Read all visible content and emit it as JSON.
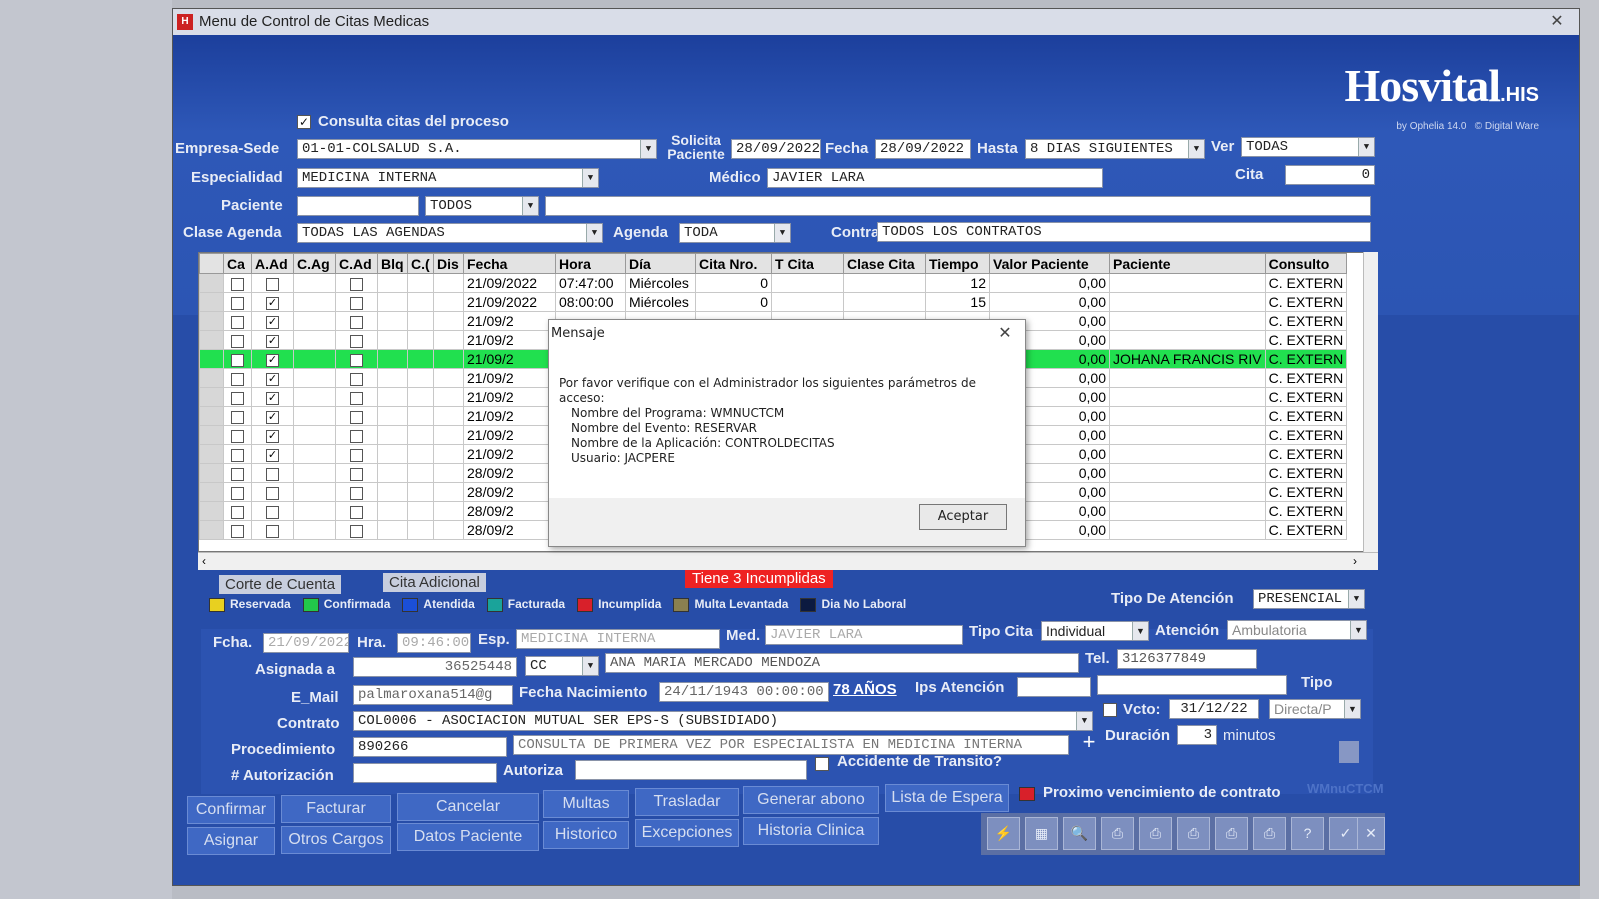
{
  "window": {
    "title": "Menu de Control de Citas Medicas",
    "close": "✕"
  },
  "logo": {
    "main": "Hosvital",
    "suffix": ".HIS",
    "by": "by Ophelia 14.0",
    "copyright": "© Digital Ware"
  },
  "filters": {
    "consulta_label": "Consulta citas del proceso",
    "empresa_label": "Empresa-Sede",
    "empresa_value": "01-01-COLSALUD S.A.",
    "solicita_label": "Solicita Paciente",
    "solicita_value": "28/09/2022",
    "fecha_label": "Fecha",
    "fecha_value": "28/09/2022",
    "hasta_label": "Hasta",
    "hasta_value": "8 DIAS SIGUIENTES",
    "ver_label": "Ver",
    "ver_value": "TODAS",
    "especialidad_label": "Especialidad",
    "especialidad_value": "MEDICINA INTERNA",
    "medico_label": "Médico",
    "medico_value": "JAVIER  LARA",
    "cita_label": "Cita",
    "cita_value": "0",
    "paciente_label": "Paciente",
    "paciente_value": "",
    "paciente_filter": "TODOS",
    "clase_label": "Clase Agenda",
    "clase_value": "TODAS LAS AGENDAS",
    "agenda_label": "Agenda",
    "agenda_value": "TODA",
    "contrato_label": "Contrato",
    "contrato_value": "TODOS LOS CONTRATOS"
  },
  "grid": {
    "columns": [
      "",
      "Ca",
      "A.Ad",
      "C.Ag",
      "C.Ad",
      "Blq",
      "C.(",
      "Dis",
      "Fecha",
      "Hora",
      "Día",
      "Cita Nro.",
      "T Cita",
      "Clase Cita",
      "Tiempo",
      "Valor Paciente",
      "Paciente",
      "Consulto"
    ],
    "rows": [
      {
        "ca": false,
        "aad": false,
        "cad": false,
        "fecha": "21/09/2022",
        "hora": "07:47:00",
        "dia": "Miércoles",
        "nro": "0",
        "tiempo": "12",
        "valor": "0,00",
        "paciente": "",
        "consulto": "C. EXTERN",
        "sel": false
      },
      {
        "ca": false,
        "aad": true,
        "cad": false,
        "fecha": "21/09/2022",
        "hora": "08:00:00",
        "dia": "Miércoles",
        "nro": "0",
        "tiempo": "15",
        "valor": "0,00",
        "paciente": "",
        "consulto": "C. EXTERN",
        "sel": false
      },
      {
        "ca": false,
        "aad": true,
        "cad": false,
        "fecha": "21/09/2",
        "hora": "",
        "dia": "",
        "nro": "",
        "tiempo": "",
        "valor": "0,00",
        "paciente": "",
        "consulto": "C. EXTERN",
        "sel": false
      },
      {
        "ca": false,
        "aad": true,
        "cad": false,
        "fecha": "21/09/2",
        "hora": "",
        "dia": "",
        "nro": "",
        "tiempo": "",
        "valor": "0,00",
        "paciente": "",
        "consulto": "C. EXTERN",
        "sel": false
      },
      {
        "ca": false,
        "aad": true,
        "cad": false,
        "fecha": "21/09/2",
        "hora": "",
        "dia": "",
        "nro": "",
        "tiempo": "",
        "valor": "0,00",
        "paciente": "JOHANA FRANCIS RIV",
        "consulto": "C. EXTERN",
        "sel": true
      },
      {
        "ca": false,
        "aad": true,
        "cad": false,
        "fecha": "21/09/2",
        "hora": "",
        "dia": "",
        "nro": "",
        "tiempo": "",
        "valor": "0,00",
        "paciente": "",
        "consulto": "C. EXTERN",
        "sel": false
      },
      {
        "ca": false,
        "aad": true,
        "cad": false,
        "fecha": "21/09/2",
        "hora": "",
        "dia": "",
        "nro": "",
        "tiempo": "",
        "valor": "0,00",
        "paciente": "",
        "consulto": "C. EXTERN",
        "sel": false
      },
      {
        "ca": false,
        "aad": true,
        "cad": false,
        "fecha": "21/09/2",
        "hora": "",
        "dia": "",
        "nro": "",
        "tiempo": "",
        "valor": "0,00",
        "paciente": "",
        "consulto": "C. EXTERN",
        "sel": false
      },
      {
        "ca": false,
        "aad": true,
        "cad": false,
        "fecha": "21/09/2",
        "hora": "",
        "dia": "",
        "nro": "",
        "tiempo": "",
        "valor": "0,00",
        "paciente": "",
        "consulto": "C. EXTERN",
        "sel": false
      },
      {
        "ca": false,
        "aad": true,
        "cad": false,
        "fecha": "21/09/2",
        "hora": "",
        "dia": "",
        "nro": "",
        "tiempo": "",
        "valor": "0,00",
        "paciente": "",
        "consulto": "C. EXTERN",
        "sel": false
      },
      {
        "ca": false,
        "aad": false,
        "cad": false,
        "fecha": "28/09/2",
        "hora": "",
        "dia": "",
        "nro": "",
        "tiempo": "",
        "valor": "0,00",
        "paciente": "",
        "consulto": "C. EXTERN",
        "sel": false
      },
      {
        "ca": false,
        "aad": false,
        "cad": false,
        "fecha": "28/09/2",
        "hora": "",
        "dia": "",
        "nro": "",
        "tiempo": "",
        "valor": "0,00",
        "paciente": "",
        "consulto": "C. EXTERN",
        "sel": false
      },
      {
        "ca": false,
        "aad": false,
        "cad": false,
        "fecha": "28/09/2",
        "hora": "",
        "dia": "",
        "nro": "",
        "tiempo": "",
        "valor": "0,00",
        "paciente": "",
        "consulto": "C. EXTERN",
        "sel": false
      },
      {
        "ca": false,
        "aad": false,
        "cad": false,
        "fecha": "28/09/2",
        "hora": "",
        "dia": "",
        "nro": "",
        "tiempo": "",
        "valor": "0,00",
        "paciente": "",
        "consulto": "C. EXTERN",
        "sel": false
      }
    ]
  },
  "dialog": {
    "title": "Mensaje",
    "line1": "Por favor verifique con el Administrador los siguientes parámetros de acceso:",
    "programa": "Nombre del Programa: WMNUCTCM",
    "evento": "Nombre del Evento: RESERVAR",
    "aplicacion": "Nombre de la Aplicación: CONTROLDECITAS",
    "usuario": "Usuario: JACPERE",
    "ok": "Aceptar"
  },
  "tabs": {
    "corte": "Corte de Cuenta",
    "adicional": "Cita Adicional",
    "incumplidas": "Tiene 3 Incumplidas"
  },
  "legend": [
    {
      "label": "Reservada",
      "color": "#e8d020"
    },
    {
      "label": "Confirmada",
      "color": "#22c84a"
    },
    {
      "label": "Atendida",
      "color": "#1b4fd8"
    },
    {
      "label": "Facturada",
      "color": "#1aa39a"
    },
    {
      "label": "Incumplida",
      "color": "#d8202a"
    },
    {
      "label": "Multa Levantada",
      "color": "#8a8050"
    },
    {
      "label": "Dia No Laboral",
      "color": "#0c1a40"
    }
  ],
  "detail": {
    "tipo_atencion_label": "Tipo De Atención",
    "tipo_atencion_value": "PRESENCIAL",
    "fcha_label": "Fcha.",
    "fcha_value": "21/09/2022",
    "hra_label": "Hra.",
    "hra_value": "09:46:00",
    "esp_label": "Esp.",
    "esp_value": "MEDICINA INTERNA",
    "med_label": "Med.",
    "med_value": "JAVIER  LARA",
    "tipo_cita_label": "Tipo Cita",
    "tipo_cita_value": "Individual",
    "atencion_label": "Atención",
    "atencion_value": "Ambulatoria",
    "asignada_label": "Asignada a",
    "asignada_value": "36525448",
    "doc_type": "CC",
    "nombre": "ANA MARIA MERCADO MENDOZA",
    "tel_label": "Tel.",
    "tel_value": "3126377849",
    "email_label": "E_Mail",
    "email_value": "palmaroxana514@g",
    "fnac_label": "Fecha Nacimiento",
    "fnac_value": "24/11/1943 00:00:00",
    "edad": "78 AÑOS",
    "ips_label": "Ips Atención",
    "ips_value": "",
    "tipo_label": "Tipo",
    "contrato_label": "Contrato",
    "contrato_value": "COL0006 - ASOCIACION MUTUAL SER EPS-S (SUBSIDIADO)",
    "vcto_label": "Vcto:",
    "vcto_value": "31/12/22",
    "directa_value": "Directa/P",
    "proc_label": "Procedimiento",
    "proc_code": "890266",
    "proc_desc": "CONSULTA DE PRIMERA VEZ POR ESPECIALISTA EN MEDICINA INTERNA",
    "duracion_label": "Duración",
    "duracion_value": "3",
    "minutos": "minutos",
    "autorizacion_label": "# Autorización",
    "autoriza_label": "Autoriza",
    "accidente_label": "Accidente de Transito?",
    "proximo_label": "Proximo vencimiento de contrato",
    "wm_label": "WMnuCTCM"
  },
  "buttons": {
    "confirmar": "Confirmar",
    "facturar": "Facturar",
    "cancelar": "Cancelar",
    "multas": "Multas",
    "trasladar": "Trasladar",
    "generar": "Generar abono",
    "lista": "Lista de Espera",
    "asignar": "Asignar",
    "otros": "Otros Cargos",
    "datos": "Datos Paciente",
    "historico": "Historico",
    "excepciones": "Excepciones",
    "historia": "Historia Clinica"
  }
}
